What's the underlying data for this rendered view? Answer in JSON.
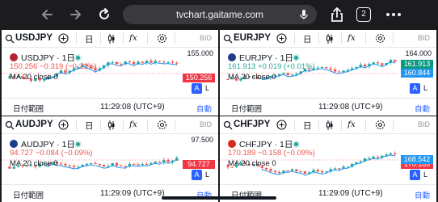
{
  "browser": {
    "url": "tvchart.gaitame.com",
    "tab_count": "2",
    "icons": [
      "back-arrow-icon",
      "forward-arrow-icon",
      "reload-icon",
      "mic-icon",
      "share-icon",
      "tabs-icon",
      "more-icon"
    ]
  },
  "toolbar_labels": {
    "interval": "日",
    "fx": "fx",
    "bid": "BID"
  },
  "panels": [
    {
      "symbol": "USDJPY",
      "legend_title": "USDJPY · 1日",
      "values_line": "150.256 −0.319 (−0.21%)",
      "ma_line": "MA 20 close 0",
      "scale_top": "155.000",
      "price_tags": [
        "150.256"
      ],
      "range_label": "日付範囲",
      "time": "11:29:08 (UTC+9)",
      "auto_label": "自動",
      "a_label": "A",
      "l_label": "L"
    },
    {
      "symbol": "EURJPY",
      "legend_title": "EURJPY · 1日",
      "values_line": "161.913 +0.019 (+0.01%)",
      "ma_line": "MA 20 close 0",
      "scale_top": "164.000",
      "price_tags": [
        "161.913",
        "160.844"
      ],
      "range_label": "日付範囲",
      "time": "11:29:08 (UTC+9)",
      "auto_label": "自動",
      "a_label": "A",
      "l_label": "L"
    },
    {
      "symbol": "AUDJPY",
      "legend_title": "AUDJPY · 1日",
      "values_line": "94.727 −0.084 (−0.09%)",
      "ma_line": "MA 20 close 0",
      "scale_top": "97.500",
      "price_tags": [
        "94.727"
      ],
      "range_label": "日付範囲",
      "time": "11:29:09 (UTC+9)",
      "auto_label": "自動",
      "a_label": "A",
      "l_label": "L"
    },
    {
      "symbol": "CHFJPY",
      "legend_title": "CHFJPY · 1日",
      "values_line": "170.189 −0.158 (−0.09%)",
      "ma_line": "MA 20 close 0",
      "scale_top": "",
      "price_tags": [
        "170.189",
        "168.542"
      ],
      "range_label": "日付範囲",
      "time": "11:29:09 (UTC+9)",
      "auto_label": "自動",
      "a_label": "A",
      "l_label": "L"
    }
  ],
  "colors": {
    "up": "#26a69a",
    "down": "#ef5350",
    "ma": "#2196f3",
    "accent": "#2962ff",
    "price_down": "#f23645",
    "price_up": "#089981"
  }
}
